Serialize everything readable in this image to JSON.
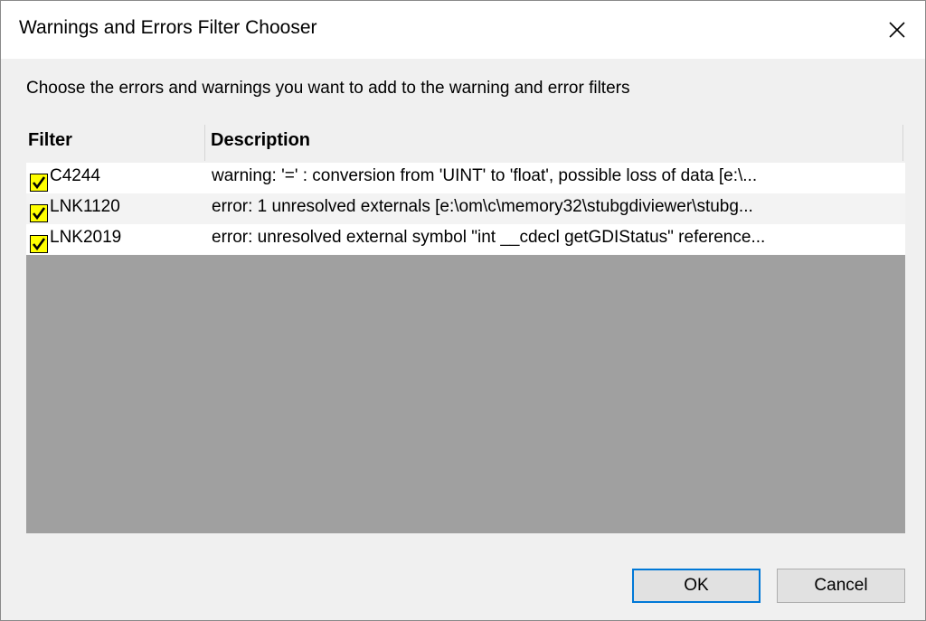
{
  "window": {
    "title": "Warnings and Errors Filter Chooser"
  },
  "instruction": "Choose the errors and warnings you want to add to the warning and error filters",
  "list": {
    "columns": [
      "Filter",
      "Description"
    ],
    "rows": [
      {
        "checked": true,
        "filter": "C4244",
        "description": "warning: '=' : conversion from 'UINT' to 'float', possible loss of data [e:\\..."
      },
      {
        "checked": true,
        "filter": "LNK1120",
        "description": "error: 1 unresolved externals [e:\\om\\c\\memory32\\stubgdiviewer\\stubg..."
      },
      {
        "checked": true,
        "filter": "LNK2019",
        "description": "error: unresolved external symbol \"int __cdecl getGDIStatus\"  reference..."
      }
    ]
  },
  "buttons": {
    "ok": "OK",
    "cancel": "Cancel"
  },
  "colors": {
    "checkbox_fill": "#ffff00",
    "empty_list_area": "#a0a0a0",
    "default_button_border": "#0078d7"
  },
  "icons": {
    "close": "close-icon",
    "check": "checkmark-icon"
  }
}
